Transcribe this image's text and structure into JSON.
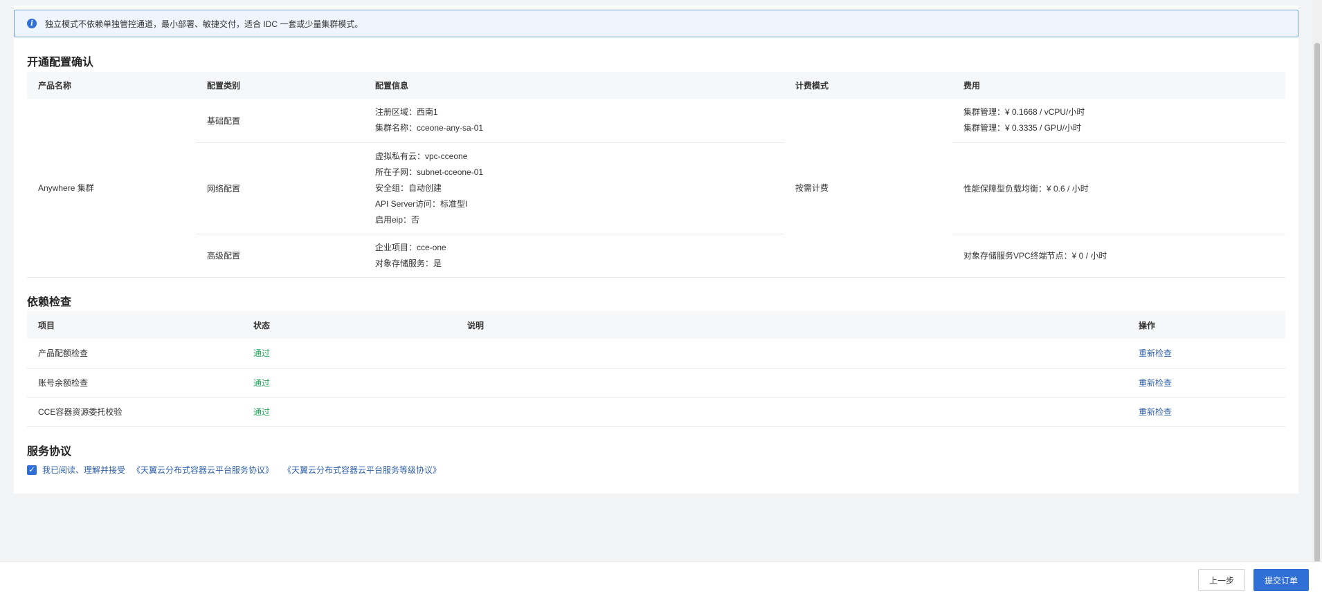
{
  "alert": {
    "text": "独立模式不依赖单独管控通道，最小部署、敏捷交付，适合 IDC 一套或少量集群模式。"
  },
  "config_section": {
    "title": "开通配置确认",
    "columns": [
      "产品名称",
      "配置类别",
      "配置信息",
      "计费模式",
      "费用"
    ],
    "product_name": "Anywhere 集群",
    "billing_mode": "按需计费",
    "rows": [
      {
        "category": "基础配置",
        "info": [
          "注册区域：西南1",
          "集群名称：cceone-any-sa-01"
        ],
        "fees": [
          "集群管理：¥ 0.1668 / vCPU/小时",
          "集群管理：¥ 0.3335 / GPU/小时"
        ]
      },
      {
        "category": "网络配置",
        "info": [
          "虚拟私有云：vpc-cceone",
          "所在子网：subnet-cceone-01",
          "安全组：自动创建",
          "API Server访问：标准型I",
          "启用eip：否"
        ],
        "fees": [
          "性能保障型负载均衡：¥ 0.6 / 小时"
        ]
      },
      {
        "category": "高级配置",
        "info": [
          "企业项目：cce-one",
          "对象存储服务：是"
        ],
        "fees": [
          "对象存储服务VPC终端节点：¥ 0 / 小时"
        ]
      }
    ]
  },
  "dependency_section": {
    "title": "依赖检查",
    "columns": [
      "项目",
      "状态",
      "说明",
      "操作"
    ],
    "rows": [
      {
        "item": "产品配额检查",
        "status": "通过",
        "desc": "",
        "action": "重新检查"
      },
      {
        "item": "账号余额检查",
        "status": "通过",
        "desc": "",
        "action": "重新检查"
      },
      {
        "item": "CCE容器资源委托校验",
        "status": "通过",
        "desc": "",
        "action": "重新检查"
      }
    ]
  },
  "agreement_section": {
    "title": "服务协议",
    "checked": true,
    "label": "我已阅读、理解并接受",
    "doc1": "《天翼云分布式容器云平台服务协议》",
    "doc2": "《天翼云分布式容器云平台服务等级协议》"
  },
  "footer": {
    "prev_label": "上一步",
    "submit_label": "提交订单"
  },
  "colors": {
    "primary": "#2f6fd6",
    "pass": "#24a55a",
    "link": "#2e5fa8"
  }
}
